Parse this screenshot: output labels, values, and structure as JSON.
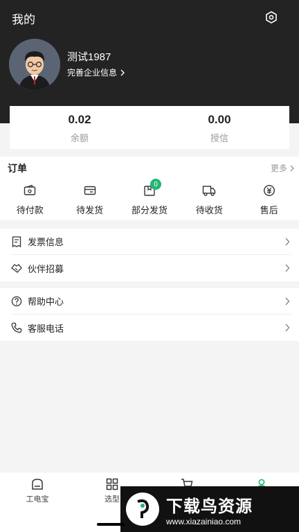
{
  "header": {
    "title": "我的",
    "user_name": "测试1987",
    "company_link": "完善企业信息"
  },
  "balance": [
    {
      "value": "0.02",
      "label": "余额"
    },
    {
      "value": "0.00",
      "label": "授信"
    }
  ],
  "orders": {
    "title": "订单",
    "more": "更多",
    "items": [
      {
        "label": "待付款",
        "icon": "wallet-icon"
      },
      {
        "label": "待发货",
        "icon": "card-icon"
      },
      {
        "label": "部分发货",
        "icon": "package-icon",
        "badge": "0"
      },
      {
        "label": "待收货",
        "icon": "truck-icon"
      },
      {
        "label": "售后",
        "icon": "refund-icon"
      }
    ]
  },
  "menu": [
    {
      "label": "发票信息",
      "icon": "invoice-icon"
    },
    {
      "label": "伙伴招募",
      "icon": "handshake-icon"
    },
    {
      "label": "帮助中心",
      "icon": "help-icon"
    },
    {
      "label": "客服电话",
      "icon": "phone-icon"
    }
  ],
  "bottom_nav": [
    {
      "label": "工电宝",
      "icon": "home-icon"
    },
    {
      "label": "选型",
      "icon": "grid-icon"
    },
    {
      "label": "",
      "icon": "cart-icon"
    },
    {
      "label": "",
      "icon": "user-icon"
    }
  ],
  "watermark": {
    "title": "下载鸟资源",
    "url": "www.xiazainiao.com"
  },
  "colors": {
    "header_bg": "#232323",
    "accent": "#22b573"
  }
}
